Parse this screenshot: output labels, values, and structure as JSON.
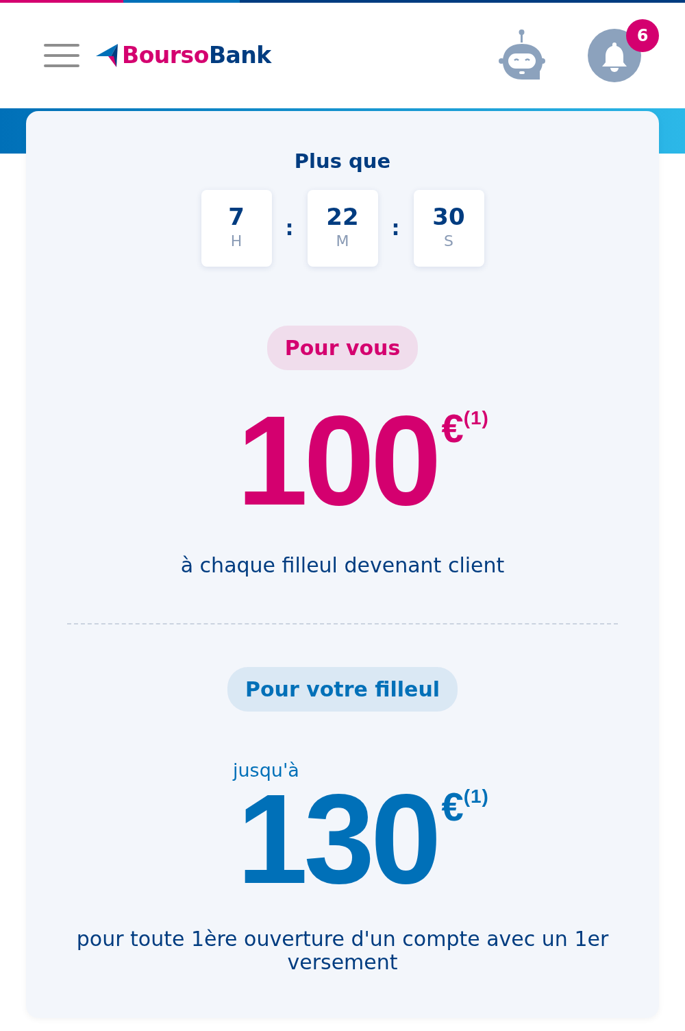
{
  "header": {
    "brand": {
      "first": "Bourso",
      "second": "Bank"
    },
    "notifications": "6"
  },
  "countdown": {
    "title": "Plus que",
    "units": [
      {
        "value": "7",
        "unit": "H"
      },
      {
        "value": "22",
        "unit": "M"
      },
      {
        "value": "30",
        "unit": "S"
      }
    ],
    "separator": ":"
  },
  "offers": [
    {
      "tag": "Pour vous",
      "color": "#d4006f",
      "amount": "100",
      "currency": "€",
      "note": "(1)",
      "description": "à chaque filleul devenant client"
    },
    {
      "tag": "Pour votre filleul",
      "color": "#0070b8",
      "prefix": "jusqu'à",
      "amount": "130",
      "currency": "€",
      "note": "(1)",
      "description": "pour toute 1ère ouverture d'un compte avec un 1er versement"
    }
  ]
}
